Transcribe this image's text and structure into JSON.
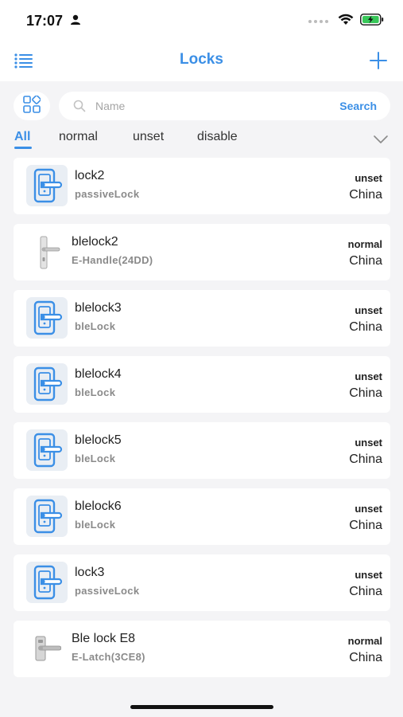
{
  "status_bar": {
    "time": "17:07"
  },
  "nav": {
    "title": "Locks"
  },
  "search": {
    "placeholder": "Name",
    "button_label": "Search"
  },
  "tabs": [
    "All",
    "normal",
    "unset",
    "disable"
  ],
  "active_tab": "All",
  "colors": {
    "accent": "#3b8fe6",
    "background": "#f4f4f6",
    "card": "#ffffff"
  },
  "locks": [
    {
      "name": "lock2",
      "type": "passiveLock",
      "status": "unset",
      "region": "China",
      "icon": "smart-lock-icon"
    },
    {
      "name": "blelock2",
      "type": "E-Handle(24DD)",
      "status": "normal",
      "region": "China",
      "icon": "handle-photo-icon"
    },
    {
      "name": "blelock3",
      "type": "bleLock",
      "status": "unset",
      "region": "China",
      "icon": "smart-lock-icon"
    },
    {
      "name": "blelock4",
      "type": "bleLock",
      "status": "unset",
      "region": "China",
      "icon": "smart-lock-icon"
    },
    {
      "name": "blelock5",
      "type": "bleLock",
      "status": "unset",
      "region": "China",
      "icon": "smart-lock-icon"
    },
    {
      "name": "blelock6",
      "type": "bleLock",
      "status": "unset",
      "region": "China",
      "icon": "smart-lock-icon"
    },
    {
      "name": "lock3",
      "type": "passiveLock",
      "status": "unset",
      "region": "China",
      "icon": "smart-lock-icon"
    },
    {
      "name": "Ble lock E8",
      "type": "E-Latch(3CE8)",
      "status": "normal",
      "region": "China",
      "icon": "latch-photo-icon"
    }
  ]
}
